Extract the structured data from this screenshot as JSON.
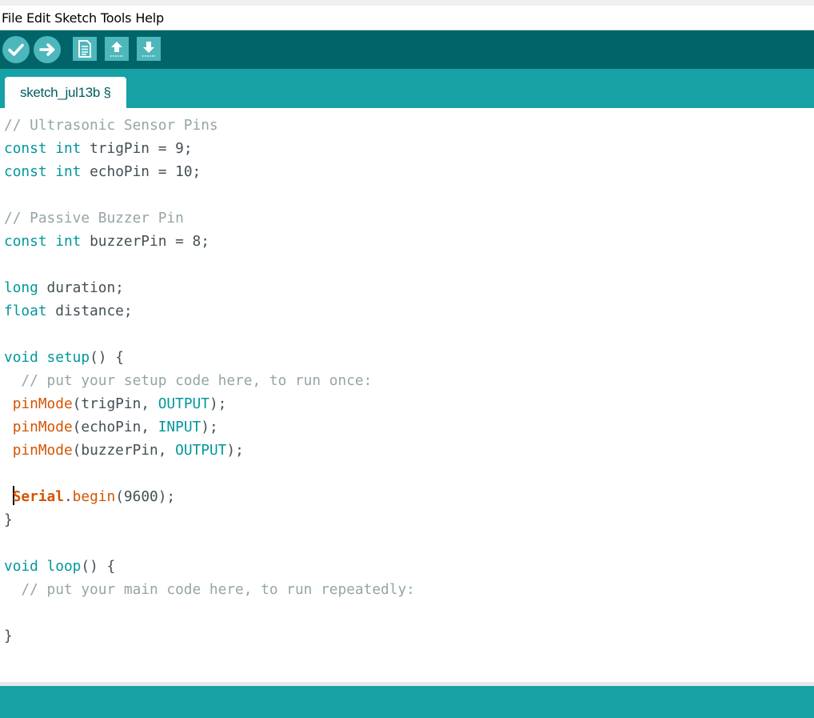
{
  "menu": {
    "items": [
      "File",
      "Edit",
      "Sketch",
      "Tools",
      "Help"
    ]
  },
  "toolbar": {
    "buttons": [
      {
        "name": "verify",
        "icon": "checkmark-icon"
      },
      {
        "name": "upload",
        "icon": "arrow-right-icon"
      },
      {
        "name": "new",
        "icon": "new-document-icon"
      },
      {
        "name": "open",
        "icon": "arrow-up-icon"
      },
      {
        "name": "save",
        "icon": "arrow-down-icon"
      }
    ]
  },
  "tab": {
    "label": "sketch_jul13b §"
  },
  "editor": {
    "lines": [
      [
        {
          "t": "// Ultrasonic Sensor Pins",
          "c": "cm"
        }
      ],
      [
        {
          "t": "const",
          "c": "kw"
        },
        {
          "t": " "
        },
        {
          "t": "int",
          "c": "kw"
        },
        {
          "t": " trigPin = 9;"
        }
      ],
      [
        {
          "t": "const",
          "c": "kw"
        },
        {
          "t": " "
        },
        {
          "t": "int",
          "c": "kw"
        },
        {
          "t": " echoPin = 10;"
        }
      ],
      [],
      [
        {
          "t": "// Passive Buzzer Pin",
          "c": "cm"
        }
      ],
      [
        {
          "t": "const",
          "c": "kw"
        },
        {
          "t": " "
        },
        {
          "t": "int",
          "c": "kw"
        },
        {
          "t": " buzzerPin = 8;"
        }
      ],
      [],
      [
        {
          "t": "long",
          "c": "kw"
        },
        {
          "t": " duration;"
        }
      ],
      [
        {
          "t": "float",
          "c": "kw"
        },
        {
          "t": " distance;"
        }
      ],
      [],
      [
        {
          "t": "void",
          "c": "kw"
        },
        {
          "t": " "
        },
        {
          "t": "setup",
          "c": "kw"
        },
        {
          "t": "() {"
        }
      ],
      [
        {
          "t": "  // put your setup code here, to run once:",
          "c": "cm"
        }
      ],
      [
        {
          "t": " "
        },
        {
          "t": "pinMode",
          "c": "fn"
        },
        {
          "t": "(trigPin, "
        },
        {
          "t": "OUTPUT",
          "c": "kw"
        },
        {
          "t": ");"
        }
      ],
      [
        {
          "t": " "
        },
        {
          "t": "pinMode",
          "c": "fn"
        },
        {
          "t": "(echoPin, "
        },
        {
          "t": "INPUT",
          "c": "kw"
        },
        {
          "t": ");"
        }
      ],
      [
        {
          "t": " "
        },
        {
          "t": "pinMode",
          "c": "fn"
        },
        {
          "t": "(buzzerPin, "
        },
        {
          "t": "OUTPUT",
          "c": "kw"
        },
        {
          "t": ");"
        }
      ],
      [],
      [
        {
          "t": " "
        },
        {
          "t": "",
          "c": "cursor"
        },
        {
          "t": "Serial",
          "c": "fnb"
        },
        {
          "t": "."
        },
        {
          "t": "begin",
          "c": "fn"
        },
        {
          "t": "(9600);"
        }
      ],
      [
        {
          "t": "}"
        }
      ],
      [],
      [
        {
          "t": "void",
          "c": "kw"
        },
        {
          "t": " "
        },
        {
          "t": "loop",
          "c": "kw"
        },
        {
          "t": "() {"
        }
      ],
      [
        {
          "t": "  // put your main code here, to run repeatedly:",
          "c": "cm"
        }
      ],
      [],
      [
        {
          "t": "}"
        }
      ]
    ]
  },
  "colors": {
    "toolbar_bg": "#006468",
    "tabbar_bg": "#17a1a5",
    "button_bg": "#4db7bb",
    "keyword": "#00979c",
    "function": "#d35400",
    "comment": "#95a5a6",
    "text": "#434f54"
  }
}
